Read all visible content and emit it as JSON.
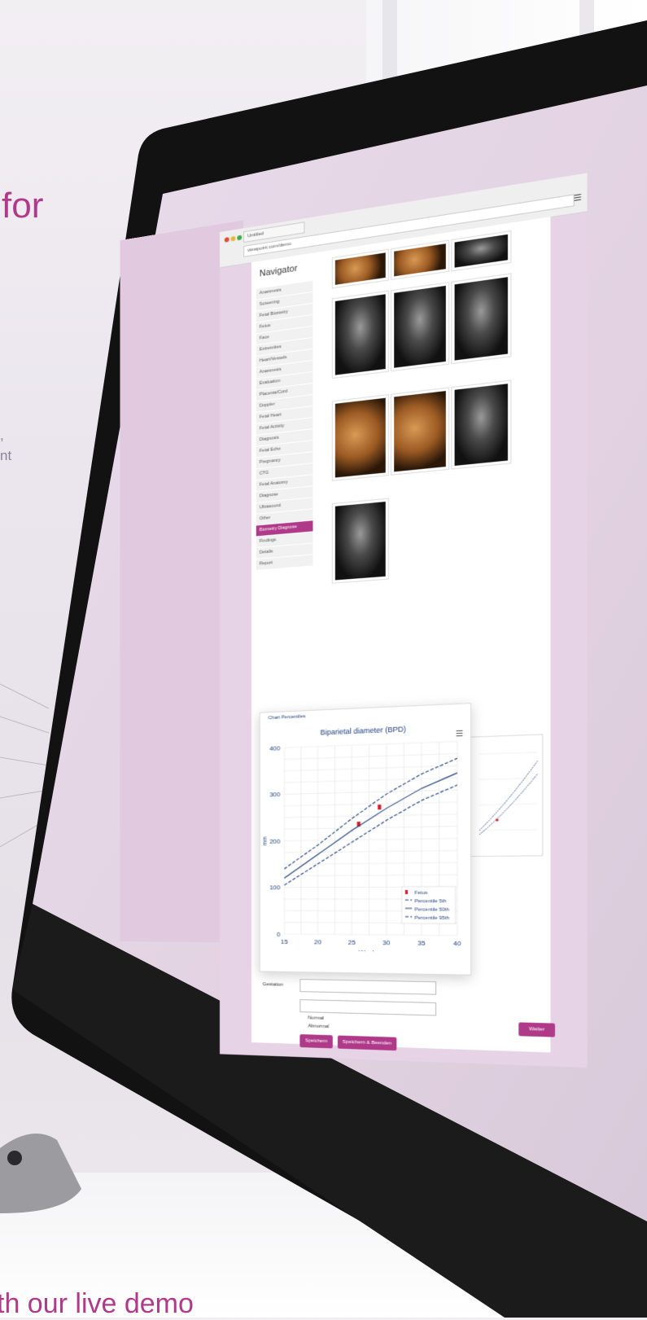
{
  "marketing": {
    "headline": "for",
    "side_line_1": ",",
    "side_line_2": "nt",
    "footer": "th our live demo"
  },
  "browser": {
    "tab_title": "Untitled",
    "url": "viewpoint.com/demo",
    "menu_icon": "hamburger-icon"
  },
  "navigator": {
    "title": "Navigator",
    "items": [
      "Anamnesis",
      "Screening",
      "Fetal Biometry",
      "Fetus",
      "Face",
      "Extremities",
      "Heart/Vessels",
      "Anamnesis",
      "Evaluation",
      "Placenta/Cord",
      "Doppler",
      "Fetal Heart",
      "Fetal Activity",
      "Diagnosis",
      "Fetal Echo",
      "Pregnancy",
      "CTG",
      "Fetal Anatomy",
      "Diagnose",
      "Ultrasound",
      "Other",
      "Biometry Diagnose",
      "Findings",
      "Details",
      "Report"
    ],
    "active_index": 21
  },
  "chart_panel": {
    "tab": "Chart Percentiles",
    "title": "Biparietal diameter (BPD)",
    "menu_icon": "hamburger-icon"
  },
  "chart_data": {
    "type": "line",
    "title": "Biparietal diameter (BPD)",
    "xlabel": "Weeks",
    "ylabel": "mm",
    "xlim": [
      15,
      40
    ],
    "ylim": [
      0,
      400
    ],
    "x_ticks": [
      "15",
      "20",
      "25",
      "30",
      "35",
      "40"
    ],
    "y_ticks": [
      "0",
      "100",
      "200",
      "300",
      "400"
    ],
    "x": [
      15,
      20,
      25,
      30,
      35,
      40
    ],
    "series": [
      {
        "name": "Fetus",
        "points": [
          [
            26,
            233
          ],
          [
            29,
            268
          ]
        ]
      },
      {
        "name": "Percentile 5th",
        "values": [
          105,
          150,
          195,
          240,
          280,
          310
        ]
      },
      {
        "name": "Percentile 50th",
        "values": [
          120,
          170,
          220,
          265,
          305,
          335
        ]
      },
      {
        "name": "Percentile 95th",
        "values": [
          140,
          190,
          245,
          295,
          335,
          365
        ]
      }
    ],
    "legend_position": "bottom-right",
    "grid": true
  },
  "form": {
    "label_result": "Gestation",
    "checkbox_1": "Normal",
    "checkbox_2": "Abnormal",
    "buttons": {
      "save": "Speichern",
      "save_close": "Speichern & Beenden",
      "next": "Weiter"
    }
  },
  "colors": {
    "accent": "#b03a8a",
    "screen_bg": "#e7d3e6",
    "chart_blue": "#1d3f7a",
    "fetus_red": "#d41c2c"
  }
}
